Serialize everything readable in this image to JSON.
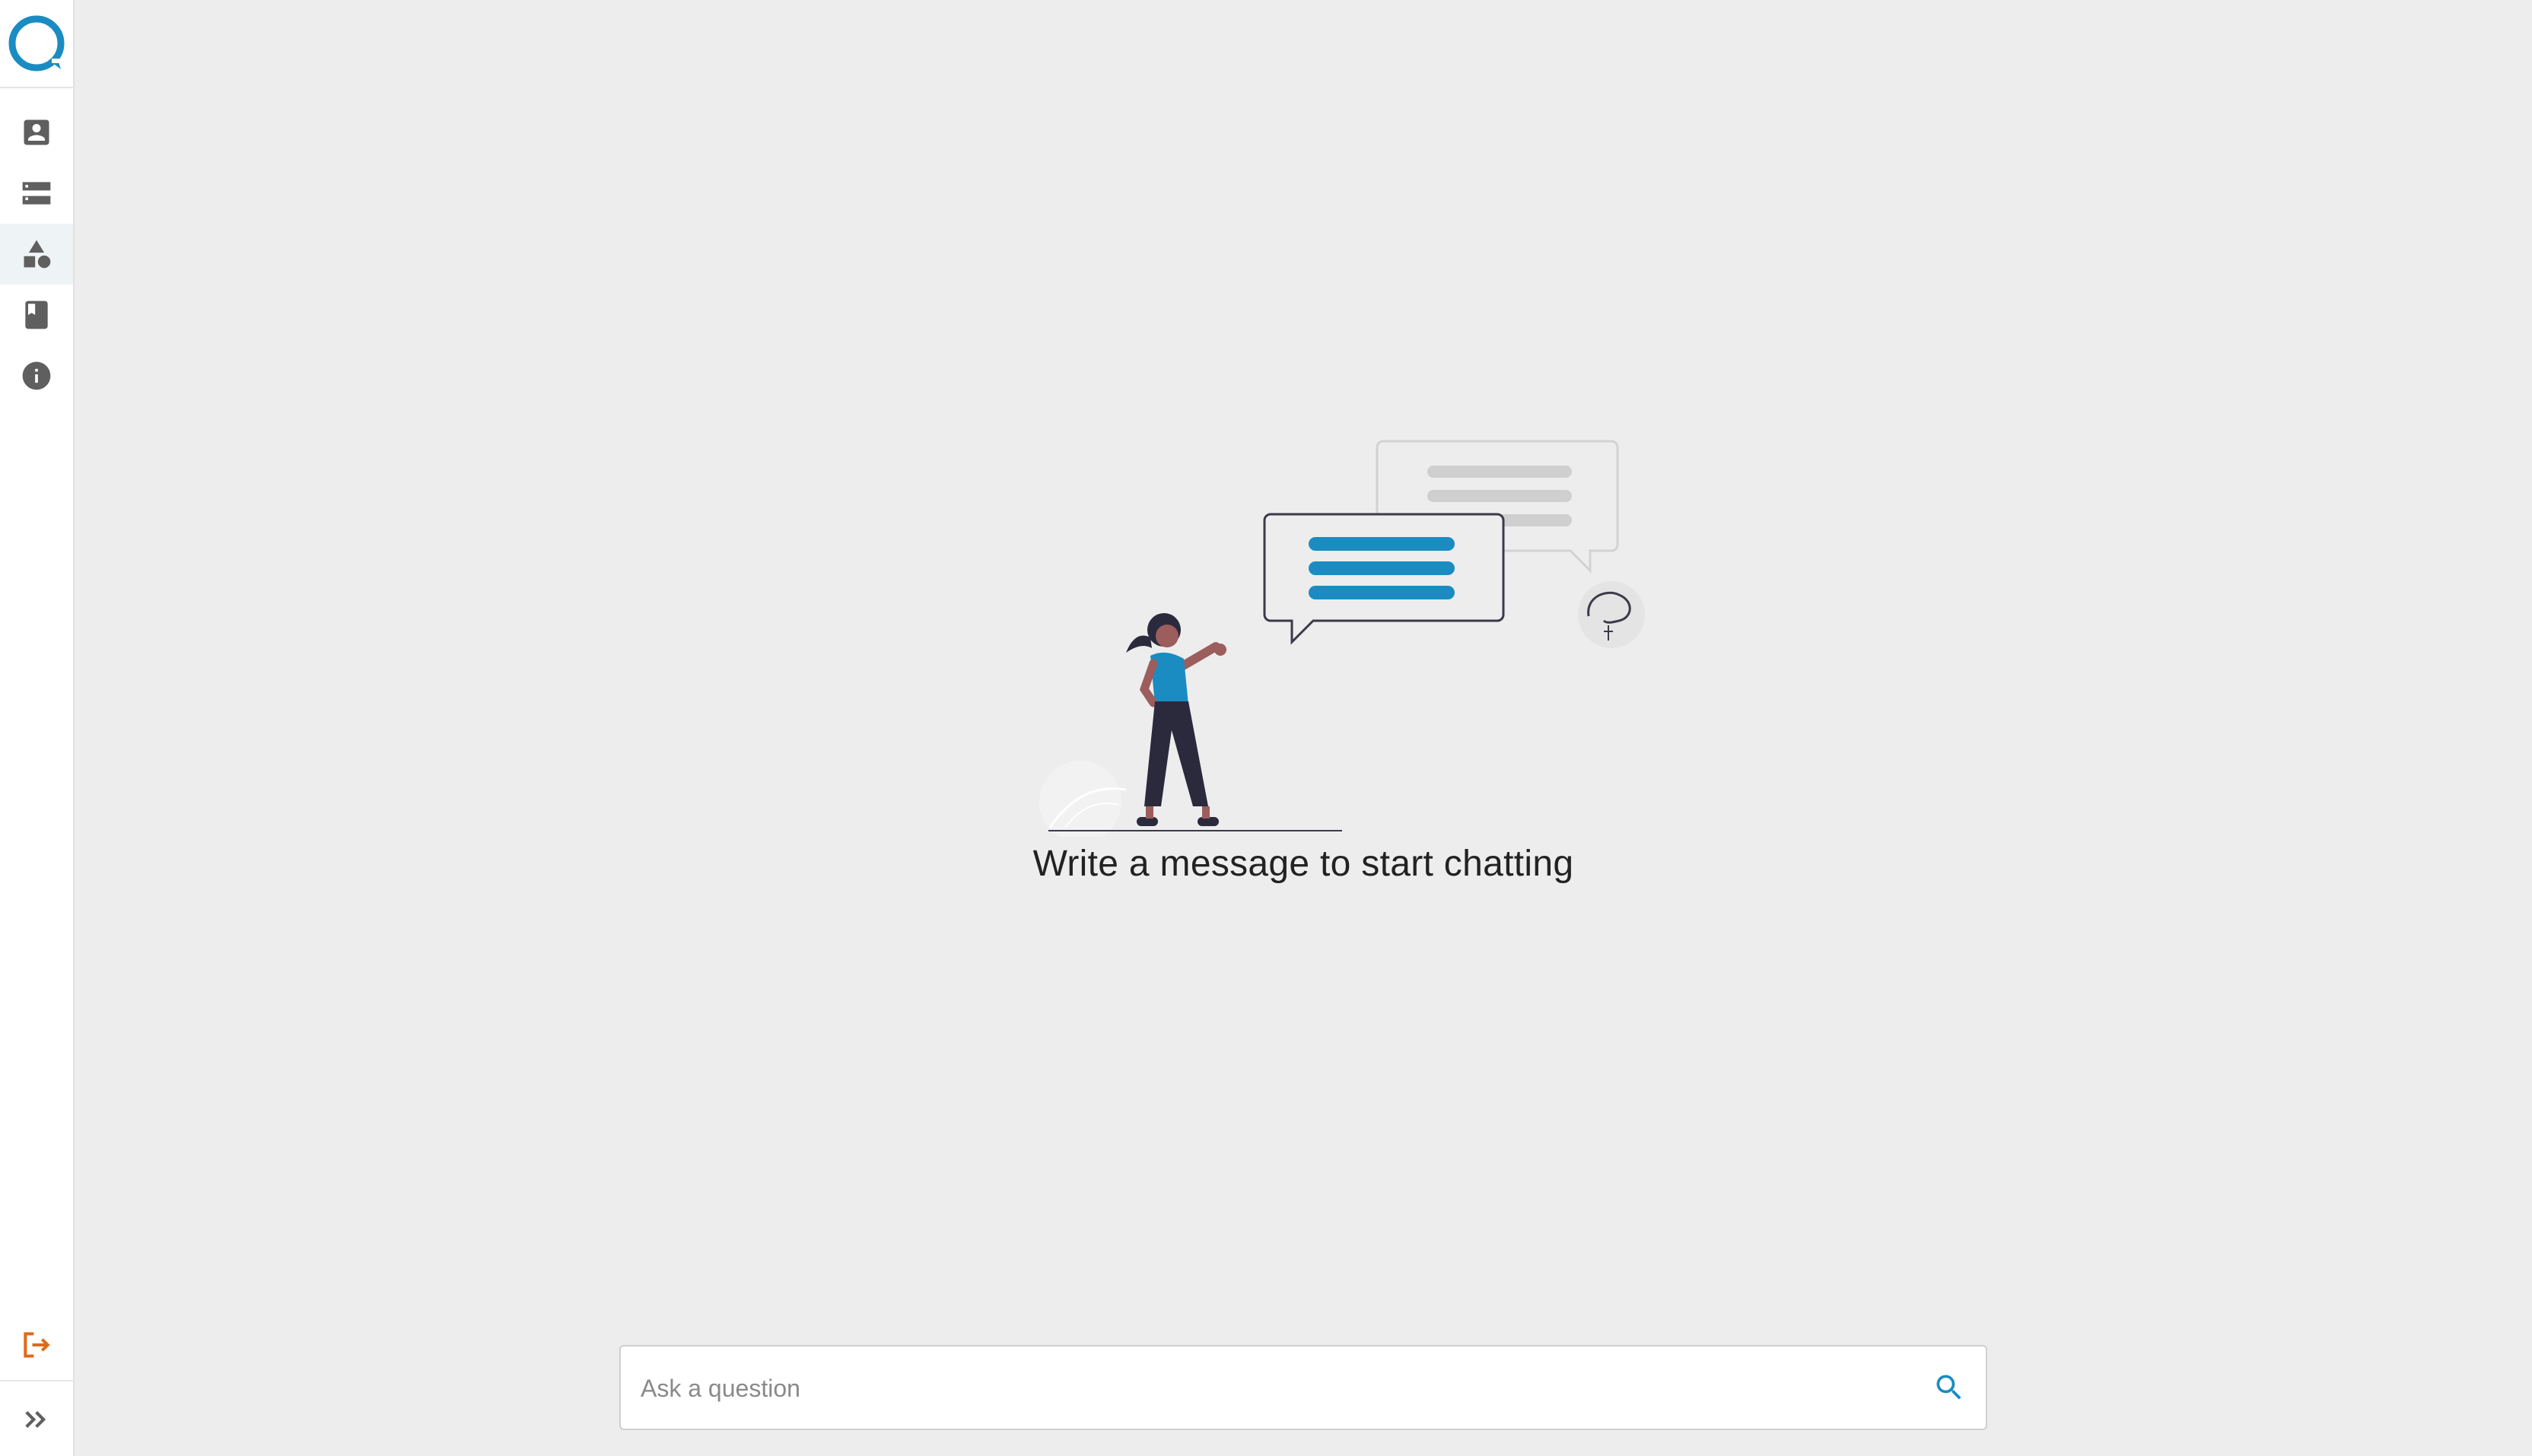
{
  "colors": {
    "accent": "#1a8cc2",
    "logout": "#e0691a",
    "icon_gray": "#5f5f5f",
    "background": "#ededed"
  },
  "sidebar": {
    "logo_icon": "chat-bubble-logo-icon",
    "items": [
      {
        "name": "profile",
        "icon": "account-box-icon",
        "active": false
      },
      {
        "name": "storage",
        "icon": "storage-icon",
        "active": false
      },
      {
        "name": "category",
        "icon": "shapes-icon",
        "active": true
      },
      {
        "name": "documentation",
        "icon": "book-icon",
        "active": false
      },
      {
        "name": "info",
        "icon": "info-icon",
        "active": false
      }
    ],
    "logout_icon": "logout-icon",
    "expand_icon": "double-chevron-right-icon"
  },
  "main": {
    "empty_state_text": "Write a message to start chatting",
    "illustration": "woman-with-chat-bubbles-illustration"
  },
  "search": {
    "placeholder": "Ask a question",
    "value": "",
    "icon": "search-icon"
  }
}
